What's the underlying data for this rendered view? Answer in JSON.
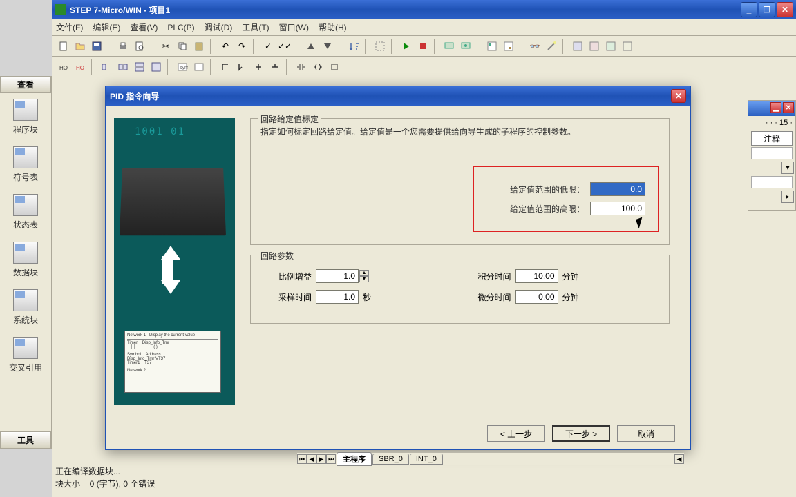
{
  "app": {
    "title": "STEP 7-Micro/WIN - 项目1"
  },
  "menu": {
    "file": "文件(F)",
    "edit": "编辑(E)",
    "view": "查看(V)",
    "plc": "PLC(P)",
    "debug": "调试(D)",
    "tools": "工具(T)",
    "window": "窗口(W)",
    "help": "帮助(H)"
  },
  "sidebar": {
    "header": "查看",
    "items": [
      {
        "label": "程序块"
      },
      {
        "label": "符号表"
      },
      {
        "label": "状态表"
      },
      {
        "label": "数据块"
      },
      {
        "label": "系统块"
      },
      {
        "label": "交叉引用"
      }
    ],
    "tools": "工具"
  },
  "dialog": {
    "title": "PID 指令向导",
    "group1": {
      "title": "回路给定值标定",
      "desc": "指定如何标定回路给定值。给定值是一个您需要提供给向导生成的子程序的控制参数。",
      "low_label": "给定值范围的低限：",
      "low_value": "0.0",
      "high_label": "给定值范围的高限：",
      "high_value": "100.0"
    },
    "group2": {
      "title": "回路参数",
      "gain_label": "比例增益",
      "gain_value": "1.0",
      "integral_label": "积分时间",
      "integral_value": "10.00",
      "integral_unit": "分钟",
      "sample_label": "采样时间",
      "sample_value": "1.0",
      "sample_unit": "秒",
      "deriv_label": "微分时间",
      "deriv_value": "0.00",
      "deriv_unit": "分钟"
    },
    "buttons": {
      "prev": "< 上一步",
      "next": "下一步 >",
      "cancel": "取消"
    }
  },
  "tabs": {
    "main": "主程序",
    "sbr": "SBR_0",
    "int": "INT_0"
  },
  "right": {
    "ruler": "15",
    "note": "注释"
  },
  "status": {
    "line1": "正在编译数据块...",
    "line2": "块大小 = 0 (字节), 0 个错误"
  }
}
